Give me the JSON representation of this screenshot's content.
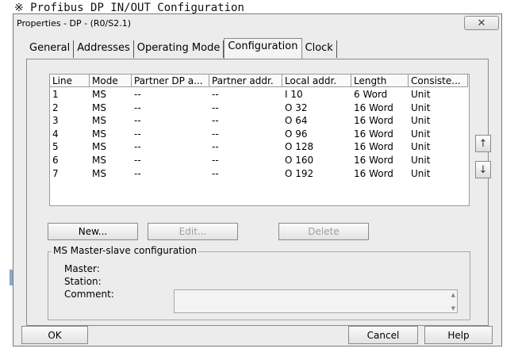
{
  "caption": "※ Profibus DP IN/OUT Configuration",
  "window": {
    "title": "Properties - DP - (R0/S2.1)",
    "close_glyph": "✕"
  },
  "tabs": [
    {
      "label": "General"
    },
    {
      "label": "Addresses"
    },
    {
      "label": "Operating Mode"
    },
    {
      "label": "Configuration"
    },
    {
      "label": "Clock"
    }
  ],
  "table": {
    "columns": [
      "Line",
      "Mode",
      "Partner DP a...",
      "Partner addr.",
      "Local addr.",
      "Length",
      "Consiste..."
    ],
    "rows": [
      [
        "1",
        "MS",
        "--",
        "--",
        "I 10",
        "6 Word",
        "Unit"
      ],
      [
        "2",
        "MS",
        "--",
        "--",
        "O 32",
        "16 Word",
        "Unit"
      ],
      [
        "3",
        "MS",
        "--",
        "--",
        "O 64",
        "16 Word",
        "Unit"
      ],
      [
        "4",
        "MS",
        "--",
        "--",
        "O 96",
        "16 Word",
        "Unit"
      ],
      [
        "5",
        "MS",
        "--",
        "--",
        "O 128",
        "16 Word",
        "Unit"
      ],
      [
        "6",
        "MS",
        "--",
        "--",
        "O 160",
        "16 Word",
        "Unit"
      ],
      [
        "7",
        "MS",
        "--",
        "--",
        "O 192",
        "16 Word",
        "Unit"
      ]
    ]
  },
  "side_buttons": {
    "up_glyph": "↑",
    "down_glyph": "↓"
  },
  "actions": {
    "new": "New...",
    "edit": "Edit...",
    "delete": "Delete"
  },
  "group": {
    "title": "MS Master-slave configuration",
    "master_label": "Master:",
    "station_label": "Station:",
    "comment_label": "Comment:",
    "comment_value": ""
  },
  "footer": {
    "ok": "OK",
    "cancel": "Cancel",
    "help": "Help"
  }
}
